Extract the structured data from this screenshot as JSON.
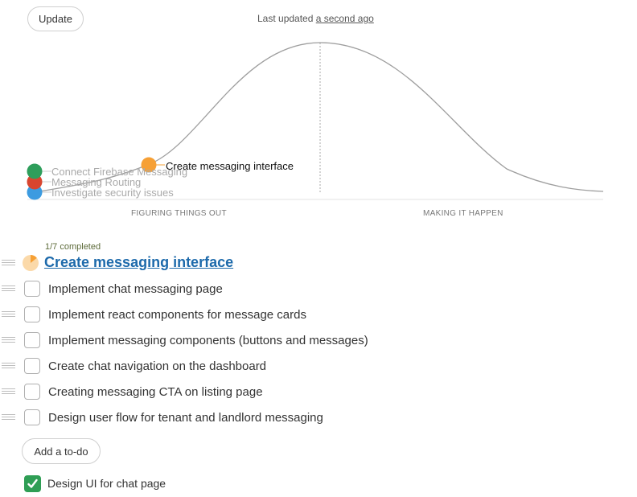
{
  "header": {
    "update_label": "Update",
    "last_updated_prefix": "Last updated ",
    "last_updated_link": "a second ago"
  },
  "hill_chart": {
    "phase_left": "FIGURING THINGS OUT",
    "phase_right": "MAKING IT HAPPEN",
    "dots": [
      {
        "label": "Connect Firebase Messaging",
        "color": "#2e9e5b"
      },
      {
        "label": "Messaging Routing",
        "color": "#d9452f"
      },
      {
        "label": "Investigate security issues",
        "color": "#3c9be0"
      },
      {
        "label": "Create messaging interface",
        "color": "#f6a035"
      }
    ]
  },
  "todo_list": {
    "completed_text": "1/7 completed",
    "progress_fraction": 0.142857,
    "title": "Create messaging interface",
    "items": [
      {
        "text": "Implement chat messaging page",
        "checked": false
      },
      {
        "text": "Implement react components for message cards",
        "checked": false
      },
      {
        "text": "Implement messaging components (buttons and messages)",
        "checked": false
      },
      {
        "text": "Create chat navigation on the dashboard",
        "checked": false
      },
      {
        "text": "Creating messaging CTA on listing page",
        "checked": false
      },
      {
        "text": "Design user flow for tenant and landlord messaging",
        "checked": false
      }
    ],
    "add_label": "Add a to-do",
    "completed_items": [
      {
        "text": "Design UI for chat page",
        "checked": true
      }
    ]
  },
  "colors": {
    "link": "#1d6aab",
    "check_green": "#2f9e55",
    "progress_orange": "#f6a035"
  }
}
